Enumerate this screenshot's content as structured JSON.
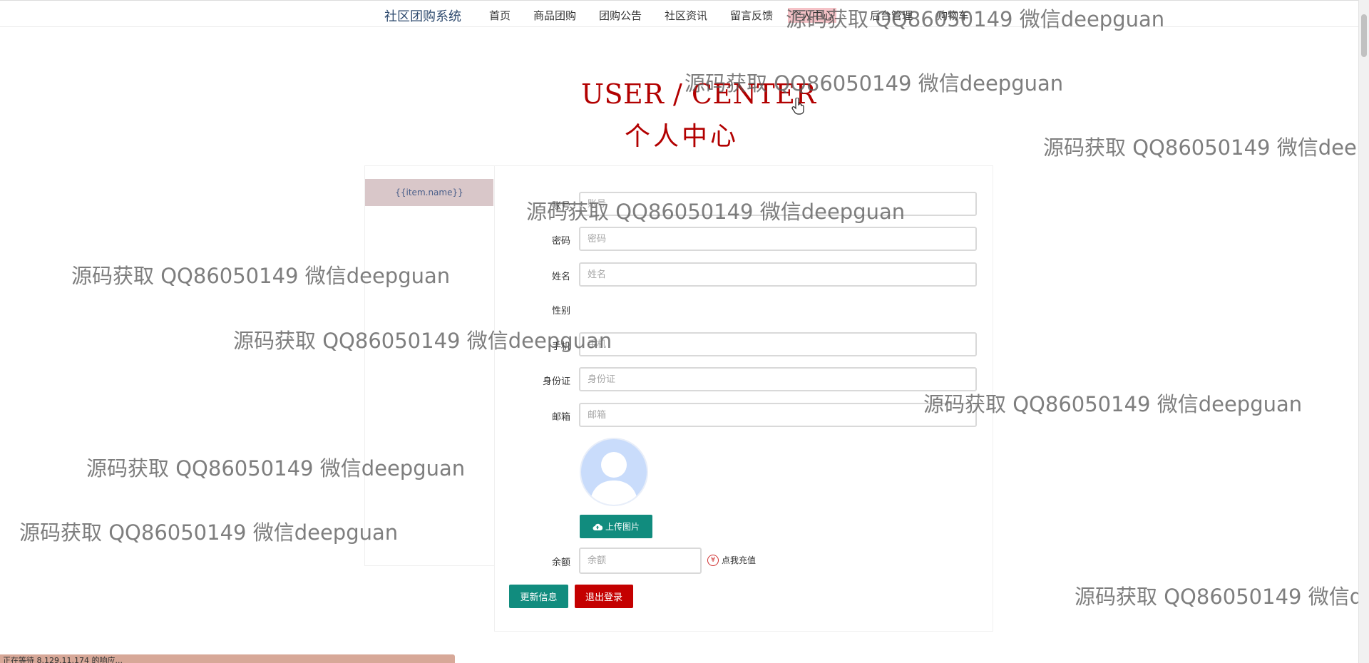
{
  "nav": {
    "brand": "社区团购系统",
    "items": [
      "首页",
      "商品团购",
      "团购公告",
      "社区资讯",
      "留言反馈",
      "个人中心",
      "后台管理",
      "购物车"
    ]
  },
  "heading": {
    "en": "USER / CENTER",
    "cn": "个人中心"
  },
  "sidebar": {
    "item": "{{item.name}}"
  },
  "form": {
    "account_label": "账号",
    "account_placeholder": "账号",
    "password_label": "密码",
    "password_placeholder": "密码",
    "name_label": "姓名",
    "name_placeholder": "姓名",
    "gender_label": "性别",
    "phone_label": "手机",
    "phone_placeholder": "手机",
    "idcard_label": "身份证",
    "idcard_placeholder": "身份证",
    "email_label": "邮箱",
    "email_placeholder": "邮箱",
    "upload_label": "上传图片",
    "balance_label": "余额",
    "balance_placeholder": "余额",
    "recharge_label": "点我充值",
    "update_button": "更新信息",
    "logout_button": "退出登录"
  },
  "statusbar": {
    "text": "正在等待 8.129.11.174 的响应..."
  },
  "watermark": "源码获取 QQ86050149 微信deepguan",
  "colors": {
    "brand_blue": "#2e4a6e",
    "heading_red": "#b20000",
    "teal_button": "#118c7e",
    "red_button": "#c40000",
    "sidebar_item_bg": "#d9c7c9"
  }
}
